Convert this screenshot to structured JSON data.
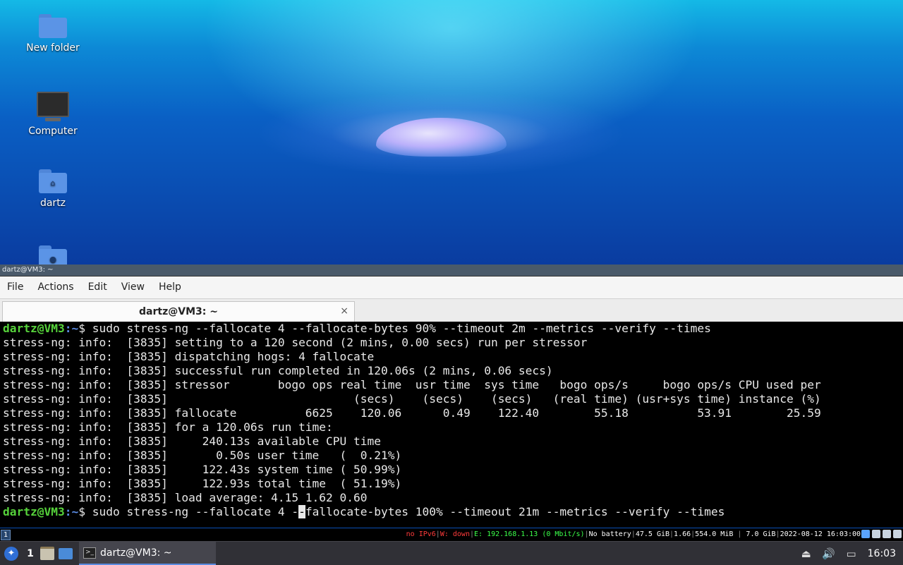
{
  "desktop": {
    "icons": [
      {
        "label": "New folder"
      },
      {
        "label": "Computer"
      },
      {
        "label": "dartz"
      },
      {
        "label": ""
      }
    ]
  },
  "window": {
    "title": "dartz@VM3: ~",
    "menu": [
      "File",
      "Actions",
      "Edit",
      "View",
      "Help"
    ],
    "tab": {
      "label": "dartz@VM3: ~",
      "close": "×"
    }
  },
  "terminal": {
    "prompt_user": "dartz@VM3",
    "prompt_path": ":~",
    "prompt_sign": "$ ",
    "command1": "sudo stress-ng --fallocate 4 --fallocate-bytes 90% --timeout 2m --metrics --verify --times",
    "output": [
      "stress-ng: info:  [3835] setting to a 120 second (2 mins, 0.00 secs) run per stressor",
      "stress-ng: info:  [3835] dispatching hogs: 4 fallocate",
      "stress-ng: info:  [3835] successful run completed in 120.06s (2 mins, 0.06 secs)",
      "stress-ng: info:  [3835] stressor       bogo ops real time  usr time  sys time   bogo ops/s     bogo ops/s CPU used per",
      "stress-ng: info:  [3835]                           (secs)    (secs)    (secs)   (real time) (usr+sys time) instance (%)",
      "stress-ng: info:  [3835] fallocate          6625    120.06      0.49    122.40        55.18          53.91        25.59",
      "stress-ng: info:  [3835] for a 120.06s run time:",
      "stress-ng: info:  [3835]     240.13s available CPU time",
      "stress-ng: info:  [3835]       0.50s user time   (  0.21%)",
      "stress-ng: info:  [3835]     122.43s system time ( 50.99%)",
      "stress-ng: info:  [3835]     122.93s total time  ( 51.19%)",
      "stress-ng: info:  [3835] load average: 4.15 1.62 0.60"
    ],
    "command2_before": "sudo stress-ng --fallocate 4 -",
    "command2_cursor": "-",
    "command2_after": "fallocate-bytes 100% --timeout 21m --metrics --verify --times"
  },
  "statusbar": {
    "workspace": "1",
    "ipv6": "no IPv6",
    "wifi": "W: down",
    "ethernet": "E: 192.168.1.13 (0 Mbit/s)",
    "battery": "No battery",
    "disk": "47.5 GiB",
    "load": "1.66",
    "mem_used": "554.0 MiB",
    "mem_total": "7.0 GiB",
    "datetime": "2022-08-12 16:03:00"
  },
  "panel": {
    "pager": "1",
    "task_label": "dartz@VM3: ~",
    "clock": "16:03"
  },
  "colors": {
    "prompt_user": "#56d23b",
    "prompt_path": "#5c8de6",
    "status_red": "#ff3b3b",
    "status_green": "#3bff4a"
  }
}
